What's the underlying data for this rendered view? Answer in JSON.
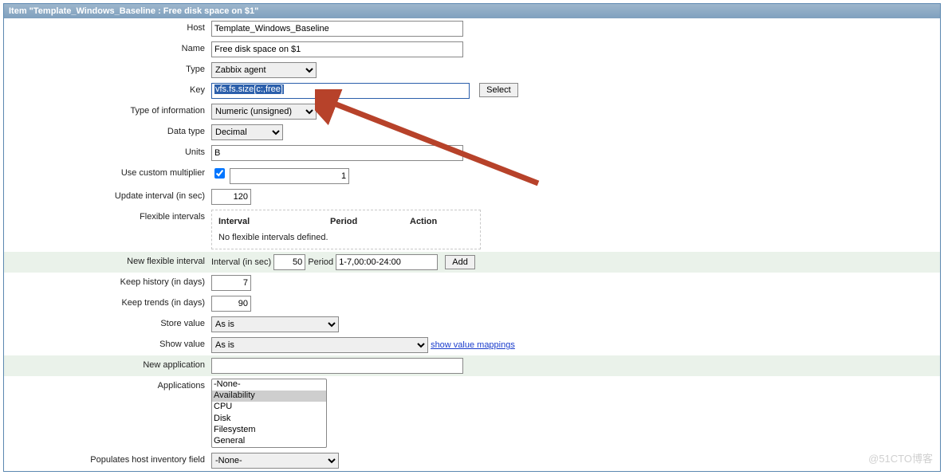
{
  "title": "Item \"Template_Windows_Baseline : Free disk space on $1\"",
  "labels": {
    "host": "Host",
    "name": "Name",
    "type": "Type",
    "key": "Key",
    "infoType": "Type of information",
    "dataType": "Data type",
    "units": "Units",
    "multiplier": "Use custom multiplier",
    "updateInterval": "Update interval (in sec)",
    "flexible": "Flexible intervals",
    "newFlexible": "New flexible interval",
    "keepHistory": "Keep history (in days)",
    "keepTrends": "Keep trends (in days)",
    "storeValue": "Store value",
    "showValue": "Show value",
    "newApp": "New application",
    "applications": "Applications",
    "inventory": "Populates host inventory field"
  },
  "values": {
    "host": "Template_Windows_Baseline",
    "name": "Free disk space on $1",
    "type": "Zabbix agent",
    "key": "vfs.fs.size[c:,free]",
    "infoType": "Numeric (unsigned)",
    "dataType": "Decimal",
    "units": "B",
    "multiplier": "1",
    "updateInterval": "120",
    "keepHistory": "7",
    "keepTrends": "90",
    "storeValue": "As is",
    "showValue": "As is",
    "newApp": "",
    "inventory": "-None-"
  },
  "buttons": {
    "select": "Select",
    "add": "Add"
  },
  "flexTable": {
    "col1": "Interval",
    "col2": "Period",
    "col3": "Action",
    "empty": "No flexible intervals defined."
  },
  "newFlex": {
    "intervalLabel": "Interval (in sec)",
    "intervalVal": "50",
    "periodLabel": "Period",
    "periodVal": "1-7,00:00-24:00"
  },
  "links": {
    "showValueMappings": "show value mappings"
  },
  "apps": [
    "-None-",
    "Availability",
    "CPU",
    "Disk",
    "Filesystem",
    "General"
  ],
  "watermark": "@51CTO博客"
}
